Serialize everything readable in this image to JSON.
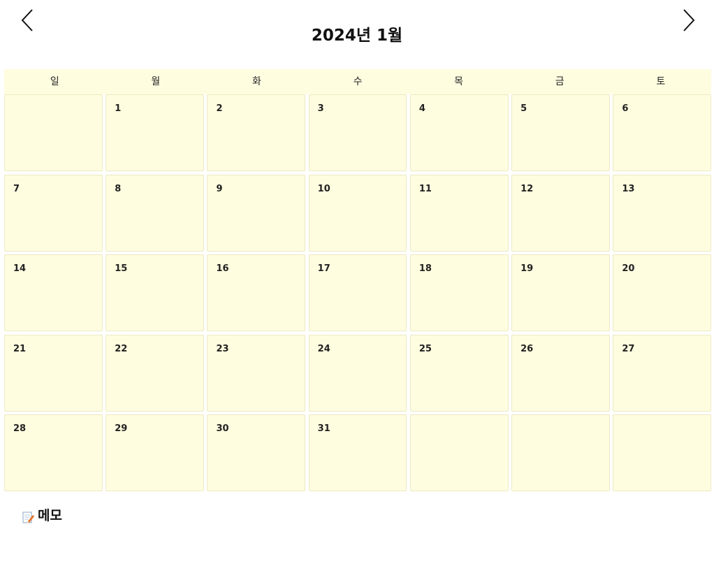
{
  "header": {
    "title": "2024년 1월",
    "prev_icon": "chevron-left-icon",
    "next_icon": "chevron-right-icon"
  },
  "weekdays": [
    "일",
    "월",
    "화",
    "수",
    "목",
    "금",
    "토"
  ],
  "weeks": [
    [
      "",
      "1",
      "2",
      "3",
      "4",
      "5",
      "6"
    ],
    [
      "7",
      "8",
      "9",
      "10",
      "11",
      "12",
      "13"
    ],
    [
      "14",
      "15",
      "16",
      "17",
      "18",
      "19",
      "20"
    ],
    [
      "21",
      "22",
      "23",
      "24",
      "25",
      "26",
      "27"
    ],
    [
      "28",
      "29",
      "30",
      "31",
      "",
      "",
      ""
    ]
  ],
  "memo": {
    "icon": "memo-pencil-icon",
    "label": "메모"
  },
  "colors": {
    "cell_background": "#fffde0",
    "cell_border": "#ece9c4"
  }
}
